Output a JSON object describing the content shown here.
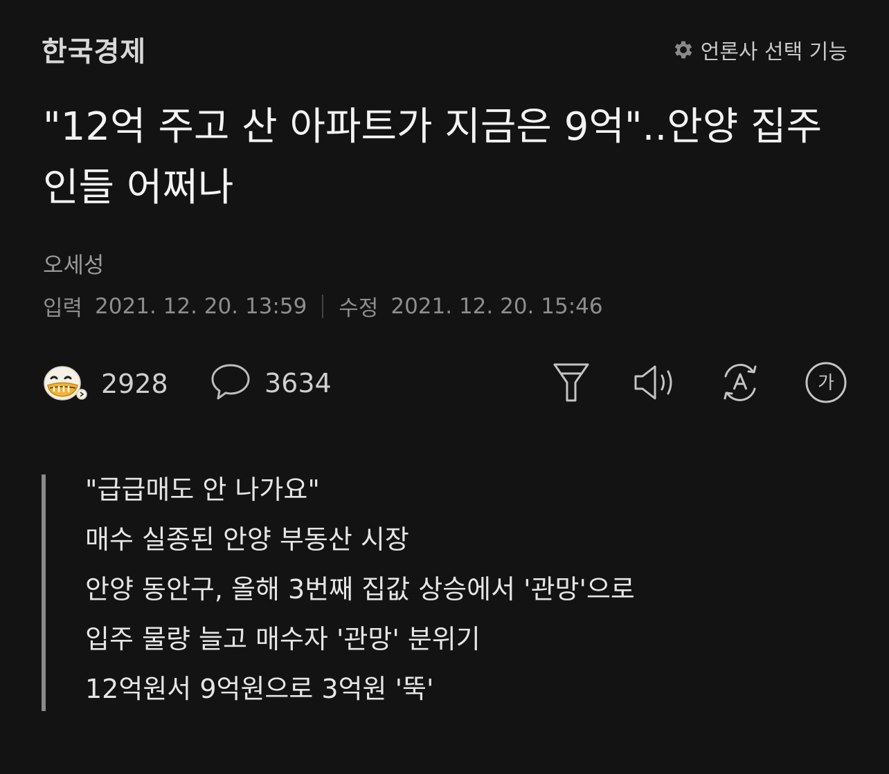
{
  "header": {
    "press_name": "한국경제",
    "press_select_label": "언론사 선택 기능"
  },
  "article": {
    "title": "\"12억 주고 산 아파트가 지금은 9억\"..안양 집주인들 어쩌나",
    "author": "오세성",
    "input_label": "입력",
    "input_time": "2021. 12. 20. 13:59",
    "modified_label": "수정",
    "modified_time": "2021. 12. 20. 15:46"
  },
  "actions": {
    "reaction_count": "2928",
    "comment_count": "3634"
  },
  "summary": [
    "\"급급매도 안 나가요\"",
    "매수 실종된 안양 부동산 시장",
    "안양 동안구, 올해 3번째 집값 상승에서 '관망'으로",
    "입주 물량 늘고 매수자 '관망' 분위기",
    "12억원서 9억원으로 3억원 '뚝'"
  ],
  "icons": {
    "settings": "gear-icon",
    "reaction": "emoji-face-icon",
    "comment": "speech-bubble-icon",
    "summary": "funnel-icon",
    "tts": "speaker-icon",
    "translate": "translate-icon",
    "font_size": "font-size-icon"
  },
  "colors": {
    "background": "#131313",
    "text": "#f3f3f3",
    "muted": "#8e8e8e",
    "emoji_face": "#f2c94c"
  }
}
